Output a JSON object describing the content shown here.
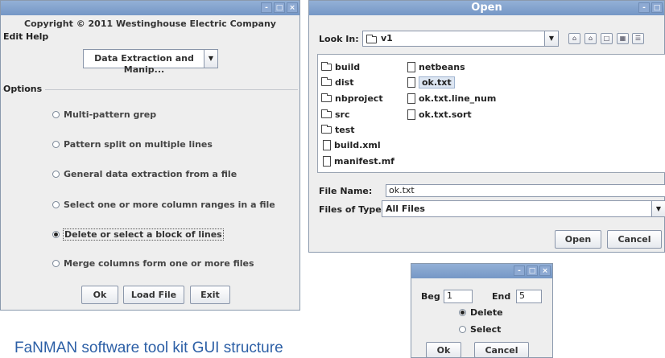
{
  "caption": "FaNMAN software tool kit GUI structure",
  "colors": {
    "titlebar": "#7e9ecb",
    "caption": "#2c5fa6"
  },
  "main_window": {
    "copyright": "Copyright © 2011 Westinghouse Electric Company",
    "menu": [
      "Edit",
      "Help"
    ],
    "dropdown_value": "Data Extraction and Manip...",
    "options_title": "Options",
    "options": [
      {
        "label": "Multi-pattern grep",
        "selected": false
      },
      {
        "label": "Pattern split on multiple lines",
        "selected": false
      },
      {
        "label": "General data extraction from a file",
        "selected": false
      },
      {
        "label": "Select one or more column ranges in a file",
        "selected": false
      },
      {
        "label": "Delete or select a block of lines",
        "selected": true
      },
      {
        "label": "Merge columns form one or more files",
        "selected": false
      }
    ],
    "buttons": [
      "Ok",
      "Load File",
      "Exit"
    ]
  },
  "open_dialog": {
    "title": "Open",
    "look_in_label": "Look In:",
    "look_in_value": "v1",
    "files_col1": [
      {
        "name": "build",
        "type": "folder"
      },
      {
        "name": "dist",
        "type": "folder"
      },
      {
        "name": "nbproject",
        "type": "folder"
      },
      {
        "name": "src",
        "type": "folder"
      },
      {
        "name": "test",
        "type": "folder"
      },
      {
        "name": "build.xml",
        "type": "file"
      },
      {
        "name": "manifest.mf",
        "type": "file"
      }
    ],
    "files_col2": [
      {
        "name": "netbeans",
        "type": "file"
      },
      {
        "name": "ok.txt",
        "type": "file",
        "selected": true
      },
      {
        "name": "ok.txt.line_num",
        "type": "file"
      },
      {
        "name": "ok.txt.sort",
        "type": "file"
      }
    ],
    "file_name_label": "File Name:",
    "file_name_value": "ok.txt",
    "file_type_label": "Files of Type:",
    "file_type_value": "All Files",
    "open_button": "Open",
    "cancel_button": "Cancel"
  },
  "small_dialog": {
    "beg_label": "Beg",
    "beg_value": "1",
    "end_label": "End",
    "end_value": "5",
    "radio_delete": "Delete",
    "radio_select": "Select",
    "ok_button": "Ok",
    "cancel_button": "Cancel"
  },
  "window_controls": [
    "-",
    "□",
    "×"
  ]
}
